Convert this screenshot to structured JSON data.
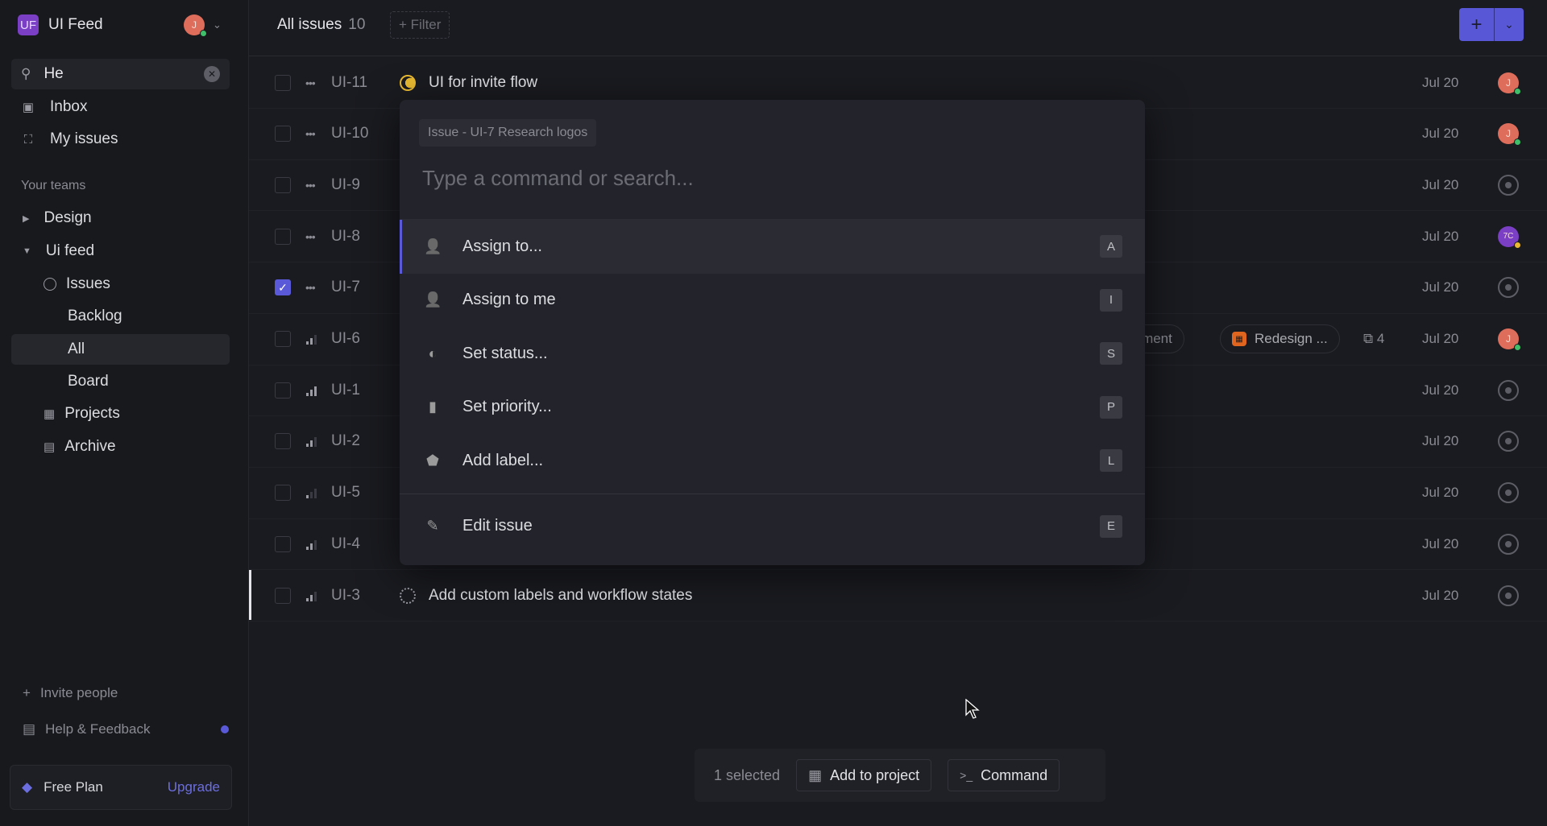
{
  "workspace": {
    "logo": "UF",
    "name": "UI Feed",
    "user_initial": "J"
  },
  "search": {
    "value": "He"
  },
  "nav": {
    "inbox": "Inbox",
    "my_issues": "My issues"
  },
  "teams": {
    "heading": "Your teams",
    "design": "Design",
    "ui_feed": "Ui feed",
    "issues": "Issues",
    "backlog": "Backlog",
    "all": "All",
    "board": "Board",
    "projects": "Projects",
    "archive": "Archive"
  },
  "footer": {
    "invite": "Invite people",
    "help": "Help & Feedback",
    "plan": "Free Plan",
    "upgrade": "Upgrade"
  },
  "header": {
    "title": "All issues",
    "count": "10",
    "filter": "+ Filter",
    "new": "+",
    "dropdown": "⌄"
  },
  "rows": [
    {
      "id": "UI-11",
      "title": "UI for invite flow",
      "date": "Jul 20",
      "avatar": "J",
      "checked": false
    },
    {
      "id": "UI-10",
      "title": "",
      "date": "Jul 20",
      "avatar": "J",
      "checked": false
    },
    {
      "id": "UI-9",
      "title": "",
      "date": "Jul 20",
      "avatar": "",
      "checked": false
    },
    {
      "id": "UI-8",
      "title": "",
      "date": "Jul 20",
      "avatar": "7C",
      "checked": false
    },
    {
      "id": "UI-7",
      "title": "",
      "date": "Jul 20",
      "avatar": "",
      "checked": true
    },
    {
      "id": "UI-6",
      "title": "",
      "date": "Jul 20",
      "avatar": "J",
      "checked": false,
      "label": "rovement",
      "project": "Redesign ...",
      "sub_count": "4"
    },
    {
      "id": "UI-1",
      "title": "",
      "date": "Jul 20",
      "avatar": "",
      "checked": false
    },
    {
      "id": "UI-2",
      "title": "",
      "date": "Jul 20",
      "avatar": "",
      "checked": false
    },
    {
      "id": "UI-5",
      "title": "",
      "date": "Jul 20",
      "avatar": "",
      "checked": false
    },
    {
      "id": "UI-4",
      "title": "",
      "date": "Jul 20",
      "avatar": "",
      "checked": false
    },
    {
      "id": "UI-3",
      "title": "Add custom labels and workflow states",
      "date": "Jul 20",
      "avatar": "",
      "checked": false
    }
  ],
  "command": {
    "context": "Issue - UI-7 Research logos",
    "placeholder": "Type a command or search...",
    "items": [
      {
        "label": "Assign to...",
        "key": "A",
        "icon": "assign-icon"
      },
      {
        "label": "Assign to me",
        "key": "I",
        "icon": "assign-me-icon"
      },
      {
        "label": "Set status...",
        "key": "S",
        "icon": "status-icon"
      },
      {
        "label": "Set priority...",
        "key": "P",
        "icon": "priority-icon"
      },
      {
        "label": "Add label...",
        "key": "L",
        "icon": "label-icon"
      },
      {
        "label": "Edit issue",
        "key": "E",
        "icon": "pencil-icon"
      }
    ]
  },
  "selection_bar": {
    "count": "1 selected",
    "add_to_project": "Add to project",
    "command": "Command"
  },
  "colors": {
    "accent": "#5a5ad8",
    "avatar": "#de6e5b",
    "avatar_alt": "#7a3fc4",
    "project": "#e0651f",
    "in_progress": "#e8b931"
  }
}
